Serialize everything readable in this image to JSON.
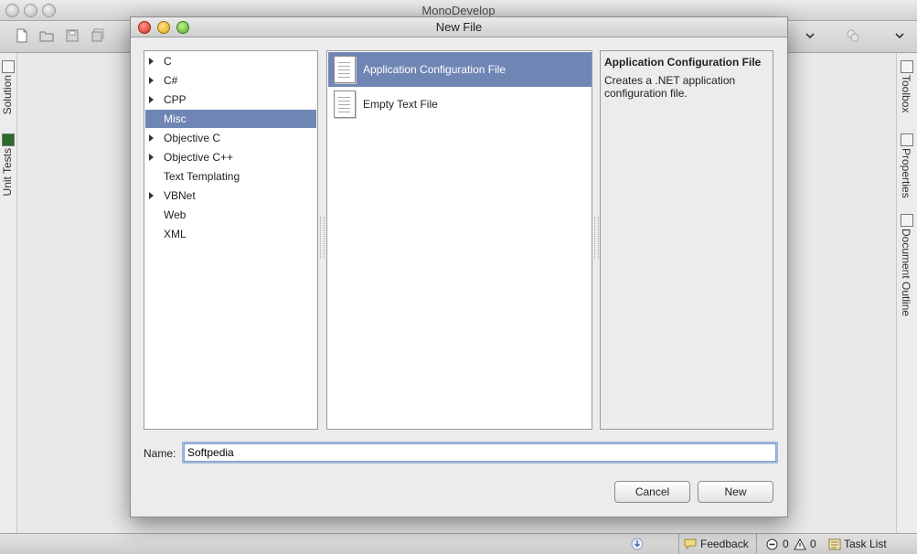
{
  "main_window": {
    "title": "MonoDevelop"
  },
  "left_pads": [
    {
      "label": "Solution",
      "icon": "solution-icon"
    },
    {
      "label": "Unit Tests",
      "icon": "unit-tests-icon"
    }
  ],
  "right_pads": [
    {
      "label": "Toolbox",
      "icon": "toolbox-icon"
    },
    {
      "label": "Properties",
      "icon": "properties-icon"
    },
    {
      "label": "Document Outline",
      "icon": "document-outline-icon"
    }
  ],
  "statusbar": {
    "feedback": "Feedback",
    "errors": "0",
    "warnings": "0",
    "task_list": "Task List"
  },
  "dialog": {
    "title": "New File",
    "categories": [
      {
        "label": "C",
        "expandable": true
      },
      {
        "label": "C#",
        "expandable": true
      },
      {
        "label": "CPP",
        "expandable": true
      },
      {
        "label": "Misc",
        "expandable": false,
        "selected": true
      },
      {
        "label": "Objective C",
        "expandable": true
      },
      {
        "label": "Objective C++",
        "expandable": true
      },
      {
        "label": "Text Templating",
        "expandable": false
      },
      {
        "label": "VBNet",
        "expandable": true
      },
      {
        "label": "Web",
        "expandable": false
      },
      {
        "label": "XML",
        "expandable": false
      }
    ],
    "templates": [
      {
        "label": "Application Configuration File",
        "selected": true,
        "icon": "document-icon"
      },
      {
        "label": "Empty Text File",
        "selected": false,
        "icon": "document-icon"
      }
    ],
    "description": {
      "title": "Application Configuration File",
      "text": "Creates a .NET application configuration file."
    },
    "name_label": "Name:",
    "name_value": "Softpedia",
    "cancel_label": "Cancel",
    "new_label": "New"
  },
  "colors": {
    "selection": "#6f85b4",
    "focus_ring": "#9fb7e4"
  }
}
